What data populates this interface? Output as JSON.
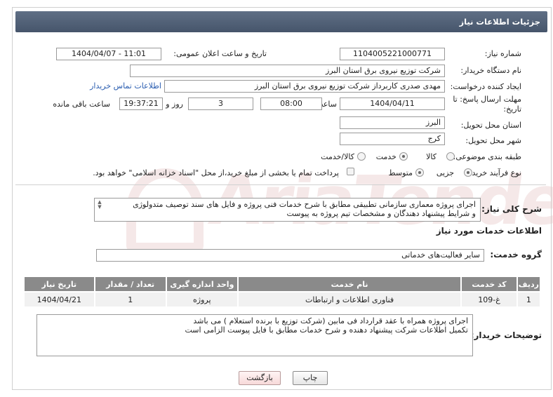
{
  "header": {
    "title": "جزئیات اطلاعات نیاز"
  },
  "form": {
    "need_number_label": "شماره نیاز:",
    "need_number": "1104005221000771",
    "announce_label": "تاریخ و ساعت اعلان عمومی:",
    "announce_value": "1404/04/07 - 11:01",
    "buyer_org_label": "نام دستگاه خریدار:",
    "buyer_org": "شرکت توزیع نیروی برق استان البرز",
    "creator_label": "ایجاد کننده درخواست:",
    "creator": "مهدی صدری کاربرداز شرکت توزیع نیروی برق استان البرز",
    "contact_link": "اطلاعات تماس خریدار",
    "deadline_label_1": "مهلت ارسال پاسخ: تا",
    "deadline_label_2": "تاریخ:",
    "deadline_date": "1404/04/11",
    "time_label": "ساعت",
    "deadline_time": "08:00",
    "days_value": "3",
    "days_label": "روز و",
    "remaining_time": "19:37:21",
    "remaining_label": "ساعت باقی مانده",
    "province_label": "استان محل تحویل:",
    "province": "البرز",
    "city_label": "شهر محل تحویل:",
    "city": "کرج",
    "category_label": "طبقه بندی موضوعی:",
    "category_options": [
      "کالا",
      "خدمت",
      "کالا/خدمت"
    ],
    "category_selected": "خدمت",
    "process_label": "نوع فرآیند خرید :",
    "process_options": [
      "جزیی",
      "متوسط"
    ],
    "process_selected": "جزیی",
    "payment_note": "پرداخت تمام یا بخشی از مبلغ خرید،از محل \"اسناد خزانه اسلامی\" خواهد بود."
  },
  "description": {
    "label": "شرح کلی نیاز:",
    "line1": "اجرای پروژه معماری سازمانی تطبیقی مطابق با شرح خدمات فنی پروژه و فایل های سند توصیف متدولوژی",
    "line2": "و شرایط پیشنهاد دهندگان و مشخصات تیم پروژه به پیوست"
  },
  "services": {
    "section_title": "اطلاعات خدمات مورد نیاز",
    "group_label": "گروه خدمت:",
    "group_value": "سایر فعالیت‌های خدماتی",
    "columns": [
      "ردیف",
      "کد خدمت",
      "نام خدمت",
      "واحد اندازه گیری",
      "تعداد / مقدار",
      "تاریخ نیاز"
    ],
    "rows": [
      {
        "index": "1",
        "code": "غ-109",
        "name": "فناوری اطلاعات و ارتباطات",
        "unit": "پروژه",
        "qty": "1",
        "date": "1404/04/21"
      }
    ]
  },
  "buyer_notes": {
    "label": "توضیحات خریدار:",
    "line1": "اجرای پروژه همراه با عقد قرارداد فی مابین (شرکت توزیع با برنده استعلام ) می باشد",
    "line2": "تکمیل اطلاعات شرکت پیشنهاد دهنده و شرح خدمات مطابق با فایل پیوست الزامی است"
  },
  "buttons": {
    "print": "چاپ",
    "back": "بازگشت"
  },
  "watermark": {
    "text": "AriaTender.net"
  }
}
